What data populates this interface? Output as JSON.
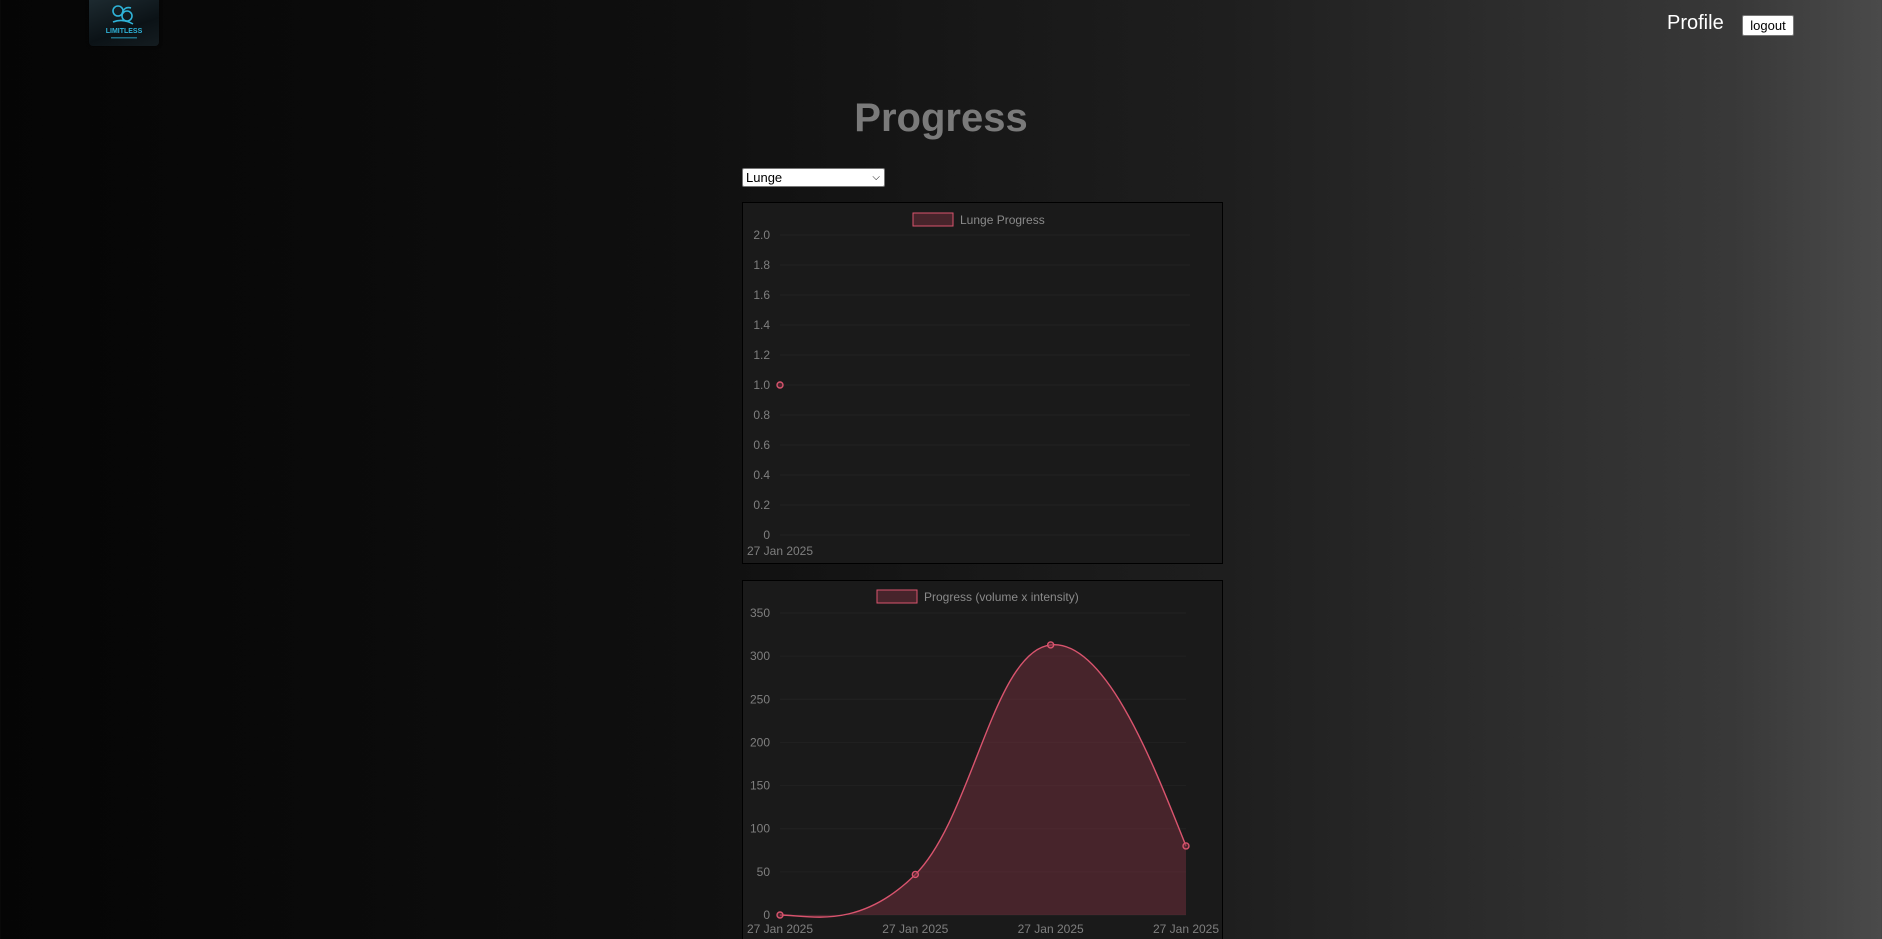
{
  "header": {
    "logo_text": "LIMITLESS",
    "profile_label": "Profile",
    "logout_label": "logout"
  },
  "page": {
    "title": "Progress"
  },
  "exercise_select": {
    "selected": "Lunge"
  },
  "colors": {
    "accent": "#d9546e",
    "fill": "rgba(110, 45, 58, 0.55)",
    "grid": "#222222",
    "tick": "#7f7f7f",
    "title": "#7a7a7a"
  },
  "chart_data": [
    {
      "type": "line",
      "legend": "Lunge Progress",
      "x": [
        "27 Jan 2025"
      ],
      "values": [
        1.0
      ],
      "ylim": [
        0,
        2.0
      ],
      "yticks": [
        "2.0",
        "1.8",
        "1.6",
        "1.4",
        "1.2",
        "1.0",
        "0.8",
        "0.6",
        "0.4",
        "0.2",
        "0"
      ],
      "grid": true
    },
    {
      "type": "area",
      "legend": "Progress (volume x intensity)",
      "x": [
        "27 Jan 2025",
        "27 Jan 2025",
        "27 Jan 2025",
        "27 Jan 2025"
      ],
      "values": [
        0,
        47,
        313,
        80
      ],
      "ylim": [
        0,
        350
      ],
      "yticks": [
        "350",
        "300",
        "250",
        "200",
        "150",
        "100",
        "50",
        "0"
      ],
      "grid": true
    }
  ]
}
